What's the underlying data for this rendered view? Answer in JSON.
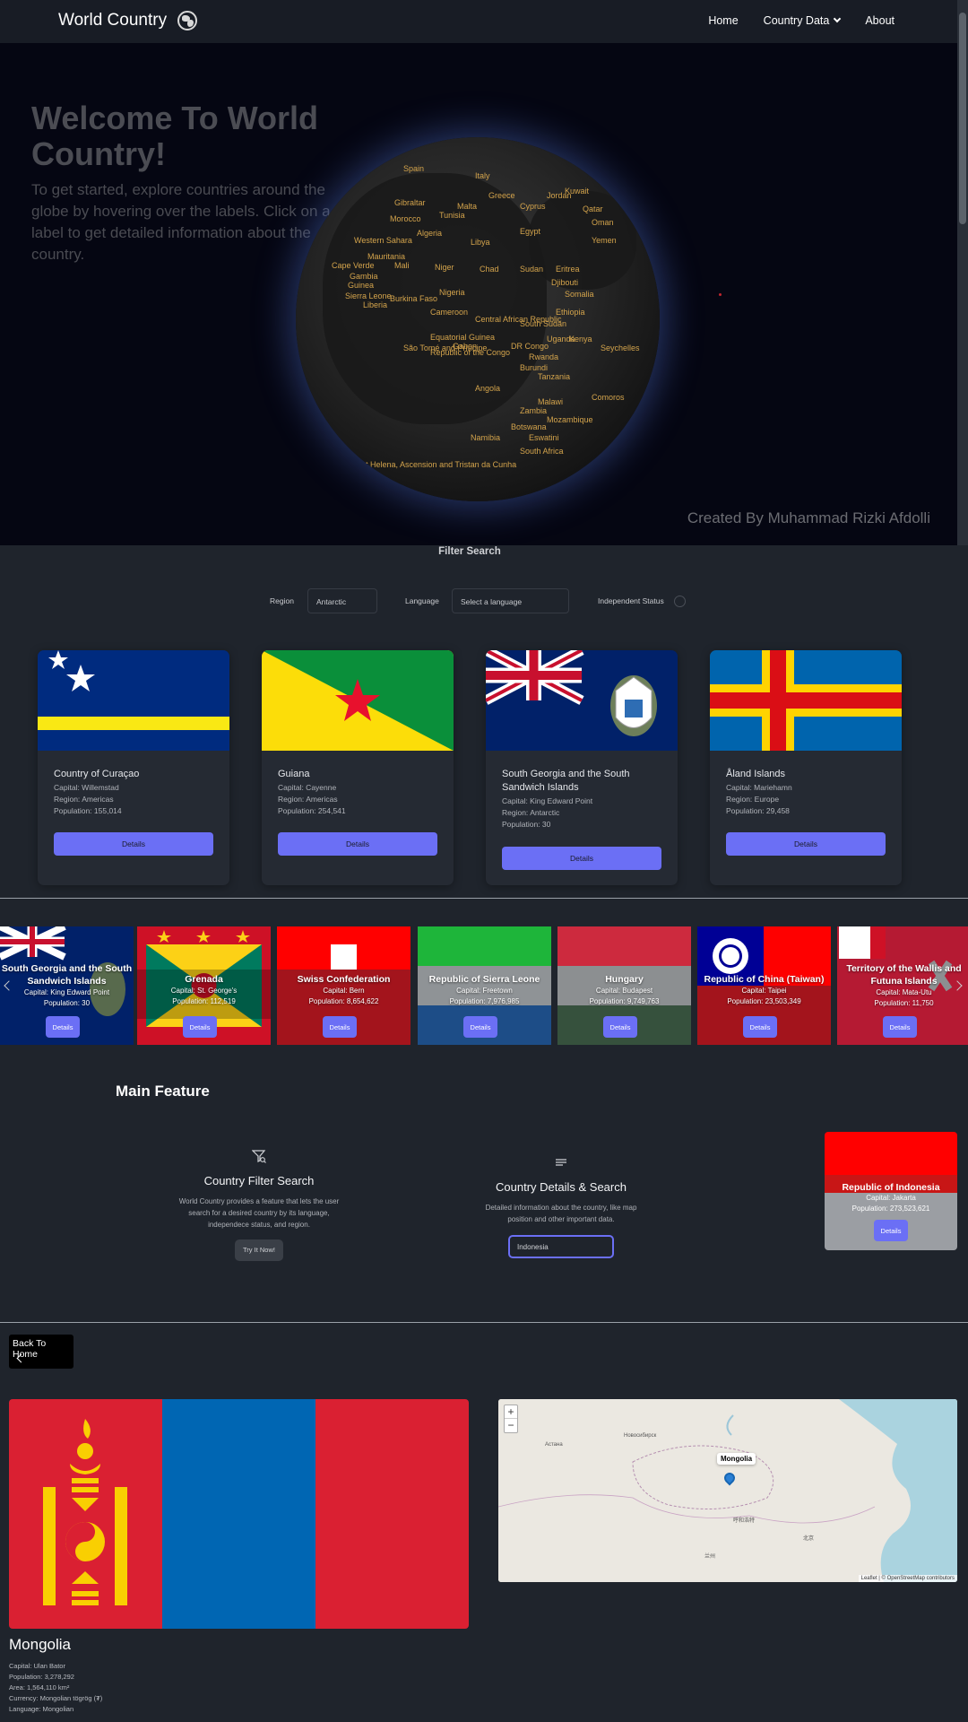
{
  "nav": {
    "brand": "World Country",
    "links": [
      "Home",
      "Country Data",
      "About"
    ]
  },
  "hero": {
    "title": "Welcome To World Country!",
    "text": "To get started, explore countries around the globe by hovering over the labels. Click on a label to get detailed information about the country.",
    "credit": "Created By Muhammad Rizki Afdolli",
    "globe_labels": [
      "Spain",
      "Italy",
      "Greece",
      "Malta",
      "Tunisia",
      "Cyprus",
      "Gibraltar",
      "Morocco",
      "Algeria",
      "Libya",
      "Egypt",
      "Jordan",
      "Kuwait",
      "Qatar",
      "Oman",
      "Yemen",
      "Western Sahara",
      "Mauritania",
      "Mali",
      "Niger",
      "Chad",
      "Sudan",
      "Eritrea",
      "Djibouti",
      "Somalia",
      "Ethiopia",
      "Cape Verde",
      "Gambia",
      "Guinea",
      "Sierra Leone",
      "Liberia",
      "Burkina Faso",
      "Nigeria",
      "Cameroon",
      "Central African Republic",
      "South Sudan",
      "Uganda",
      "Kenya",
      "Equatorial Guinea",
      "Gabon",
      "Republic of the Congo",
      "DR Congo",
      "Rwanda",
      "Burundi",
      "Tanzania",
      "Seychelles",
      "Angola",
      "Zambia",
      "Malawi",
      "Mozambique",
      "Comoros",
      "Namibia",
      "Botswana",
      "Eswatini",
      "South Africa",
      "Saint Helena, Ascension and Tristan da Cunha",
      "São Tomé and Príncipe"
    ]
  },
  "filter": {
    "title": "Filter Search",
    "region_label": "Region",
    "region_value": "Antarctic",
    "language_label": "Language",
    "language_placeholder": "Select a language",
    "independent_label": "Independent Status"
  },
  "cards": [
    {
      "name": "Country of Curaçao",
      "capital": "Capital: Willemstad",
      "region": "Region: Americas",
      "population": "Population: 155,014",
      "button": "Details"
    },
    {
      "name": "Guiana",
      "capital": "Capital: Cayenne",
      "region": "Region: Americas",
      "population": "Population: 254,541",
      "button": "Details"
    },
    {
      "name": "South Georgia and the South Sandwich Islands",
      "capital": "Capital: King Edward Point",
      "region": "Region: Antarctic",
      "population": "Population: 30",
      "button": "Details"
    },
    {
      "name": "Åland Islands",
      "capital": "Capital: Mariehamn",
      "region": "Region: Europe",
      "population": "Population: 29,458",
      "button": "Details"
    }
  ],
  "carousel": [
    {
      "name": "South Georgia and the South Sandwich Islands",
      "capital": "Capital: King Edward Point",
      "population": "Population: 30",
      "button": "Details"
    },
    {
      "name": "Grenada",
      "capital": "Capital: St. George's",
      "population": "Population: 112,519",
      "button": "Details"
    },
    {
      "name": "Swiss Confederation",
      "capital": "Capital: Bern",
      "population": "Population: 8,654,622",
      "button": "Details"
    },
    {
      "name": "Republic of Sierra Leone",
      "capital": "Capital: Freetown",
      "population": "Population: 7,976,985",
      "button": "Details"
    },
    {
      "name": "Hungary",
      "capital": "Capital: Budapest",
      "population": "Population: 9,749,763",
      "button": "Details"
    },
    {
      "name": "Republic of China (Taiwan)",
      "capital": "Capital: Taipei",
      "population": "Population: 23,503,349",
      "button": "Details"
    },
    {
      "name": "Territory of the Wallis and Futuna Islands",
      "capital": "Capital: Mata-Utu",
      "population": "Population: 11,750",
      "button": "Details"
    }
  ],
  "main_feature": {
    "title": "Main Feature",
    "feature1": {
      "icon": "filter-search-icon",
      "title": "Country Filter Search",
      "text": "World Country provides a feature that lets the user search for a desired country by its language, independece status, and region.",
      "button": "Try It Now!"
    },
    "feature2": {
      "icon": "menu-lines-icon",
      "title": "Country Details & Search",
      "text": "Detailed information about the country, like map position and other important data.",
      "input_value": "Indonesia"
    },
    "preview_card": {
      "name": "Republic of Indonesia",
      "capital": "Capital: Jakarta",
      "population": "Population: 273,523,621",
      "button": "Details"
    }
  },
  "detail": {
    "back_label": "Back To Home",
    "country": "Mongolia",
    "map_popup": "Mongolia",
    "map_zoom_in": "+",
    "map_zoom_out": "−",
    "map_attribution": "Leaflet | © OpenStreetMap contributors",
    "info": [
      "Capital: Ulan Bator",
      "Population: 3,278,292",
      "Area: 1,564,110 km²",
      "Currency: Mongolian tögrög (₮)",
      "Language: Mongolian"
    ]
  },
  "colors": {
    "accent": "#6b6ff5",
    "background": "#1f242c",
    "navbar": "#181c25",
    "globe_label": "#d4a44c"
  }
}
